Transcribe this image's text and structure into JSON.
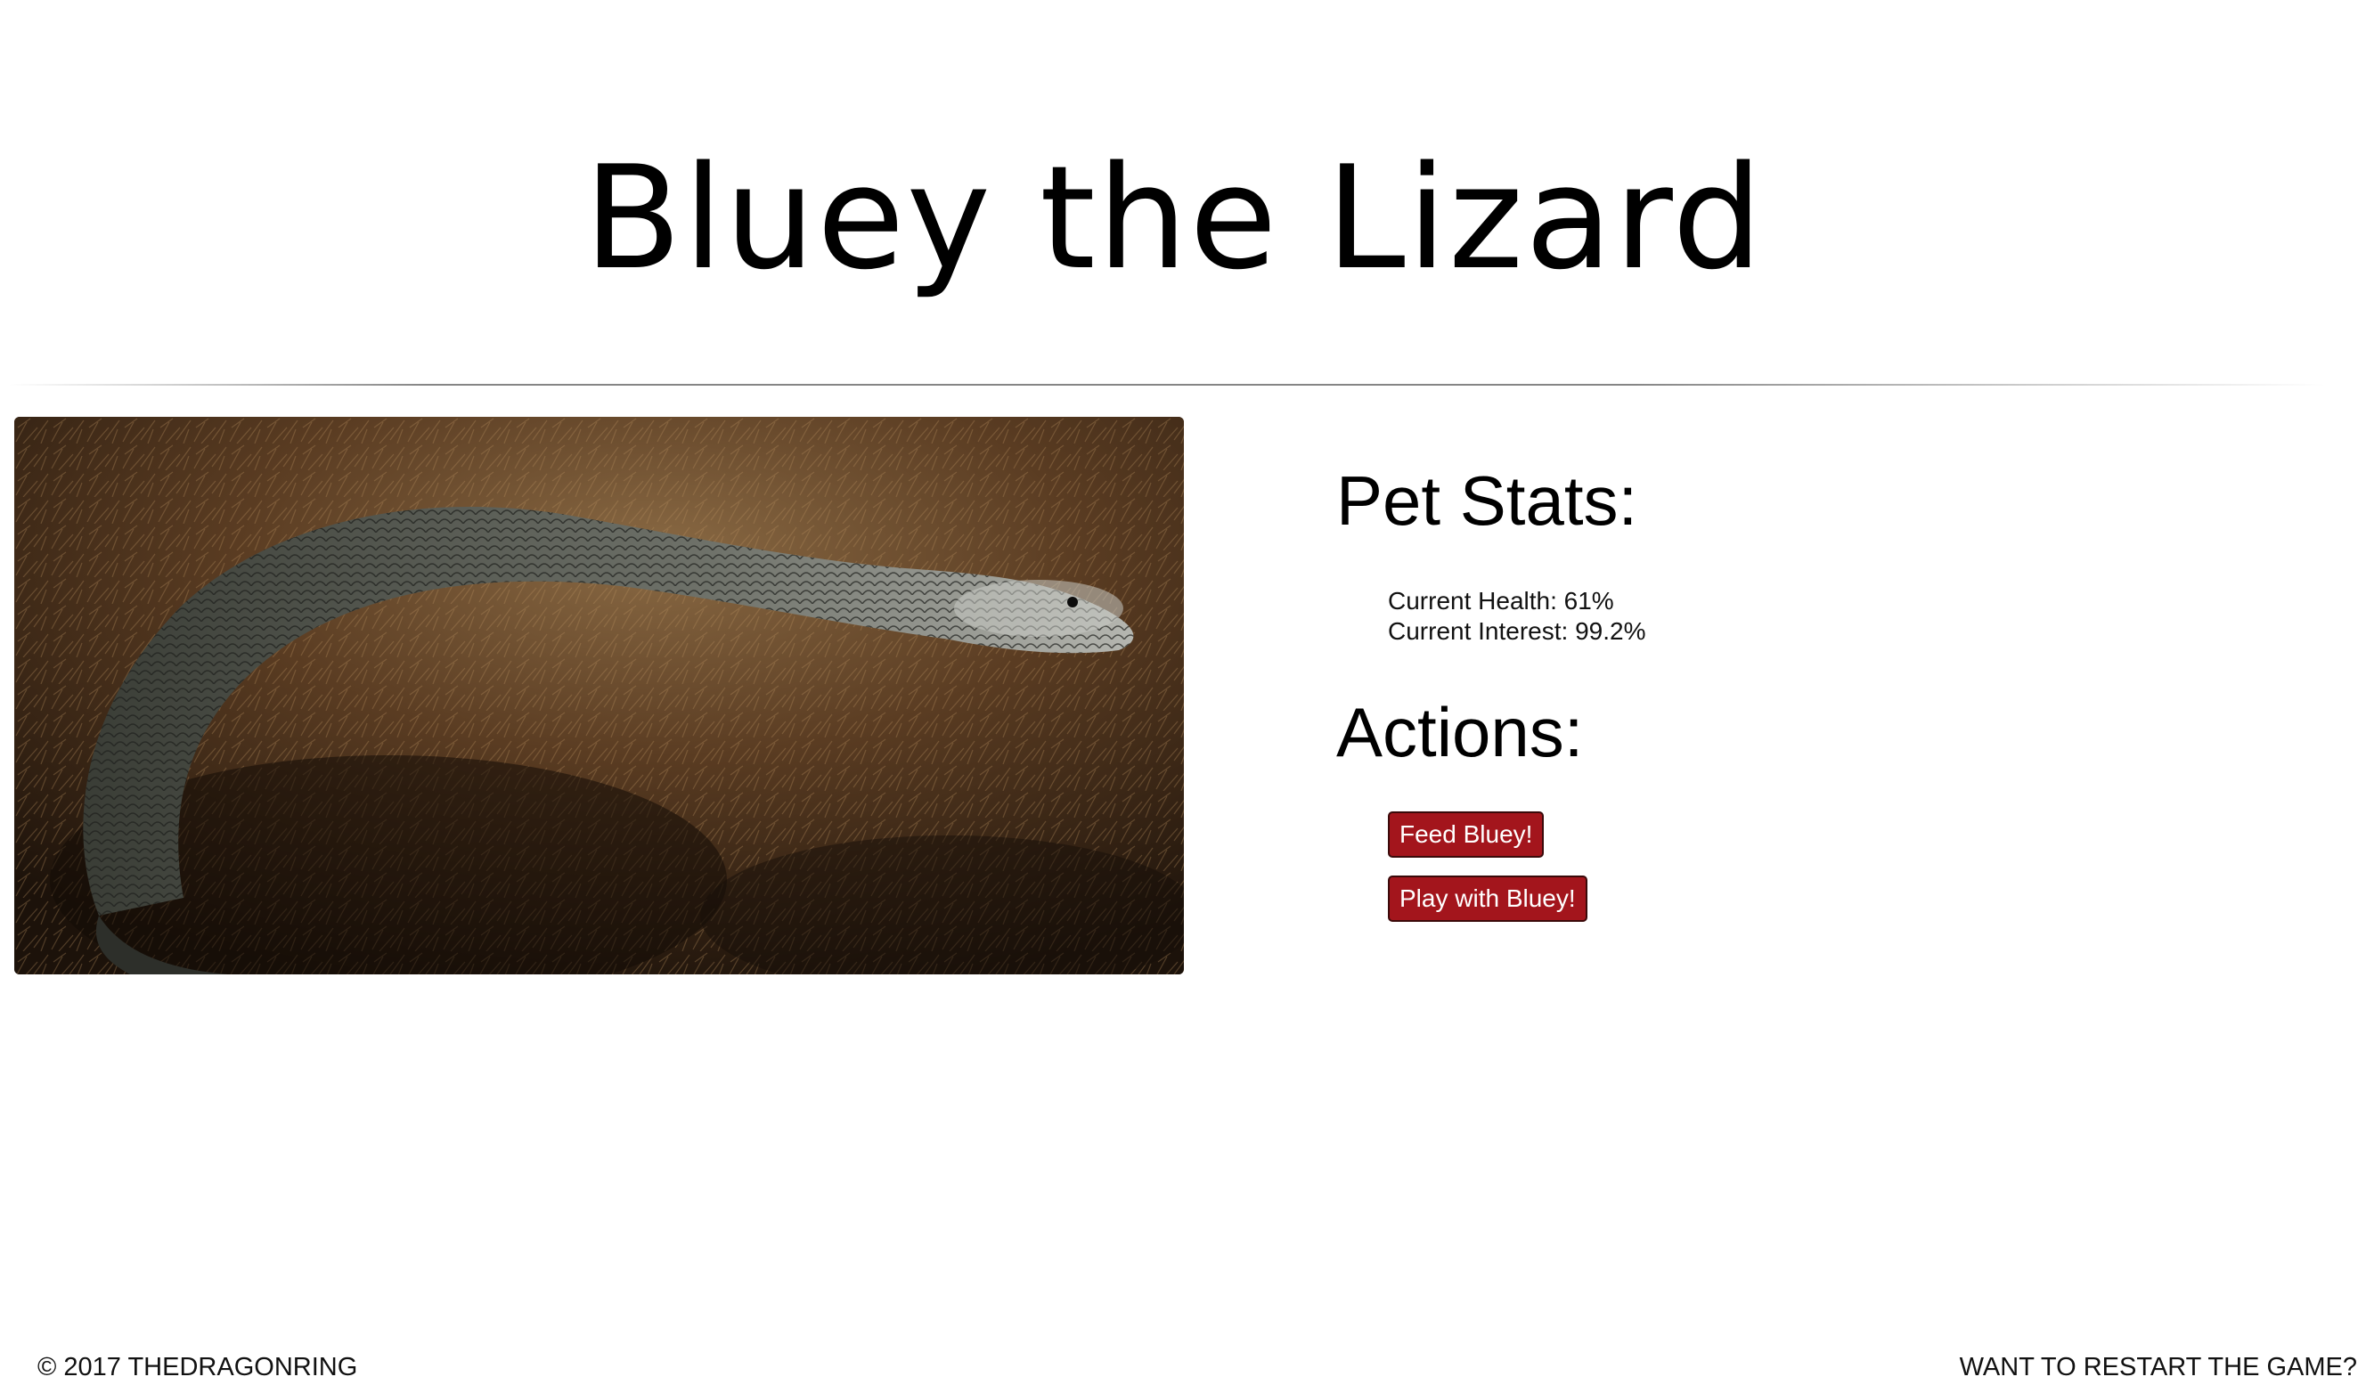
{
  "header": {
    "title": "Bluey the Lizard"
  },
  "photo": {
    "subject": "blue-tongued lizard on dry moss"
  },
  "stats": {
    "heading": "Pet Stats:",
    "health_label": "Current Health: 61%",
    "interest_label": "Current Interest: 99.2%"
  },
  "actions": {
    "heading": "Actions:",
    "feed_label": "Feed Bluey!",
    "play_label": "Play with Bluey!"
  },
  "footer": {
    "copyright": "© 2017 THEDRAGONRING",
    "restart_label": "WANT TO RESTART THE GAME?"
  },
  "colors": {
    "button_bg": "#a3151c",
    "button_border": "#3a0a0a",
    "text": "#111111"
  }
}
